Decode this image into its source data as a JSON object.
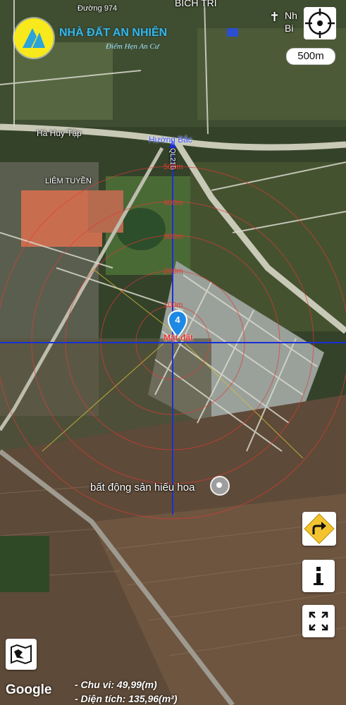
{
  "places": {
    "road_974": "Đường 974",
    "bich_tri": "BÍCH TRÌ",
    "nh_right": "Nh",
    "bi_right": "Bi",
    "ha_huy_tap": "Hà Huy Tập",
    "ql21b": "QL21B",
    "liem_tuyen": "LIÊM TUYỀN",
    "poi": "bất động sản hiếu hoa"
  },
  "brand": {
    "name": "NHÀ ĐẤT AN NHIÊN",
    "slogan": "Điểm Hẹn An Cư"
  },
  "scale_label": "500m",
  "direction_label": "Hướng Bắc",
  "rings": [
    "100m",
    "200m",
    "300m",
    "400m",
    "500m"
  ],
  "marker": {
    "number": "4",
    "label": "Mặt đất"
  },
  "footer": {
    "google": "Google",
    "perimeter": "- Chu vi: 49,99(m)",
    "area": "- Diện tích: 135,96(m²)"
  },
  "icons": {
    "compass": "compass-target-icon",
    "directions": "directions-arrow-icon",
    "info": "info-icon",
    "fullscreen": "fullscreen-icon",
    "layers": "map-layers-icon"
  },
  "colors": {
    "ring": "#e53935",
    "crosshair": "#1a2fd6",
    "logo_bg": "#f7e91b",
    "brand": "#37b7e6"
  }
}
